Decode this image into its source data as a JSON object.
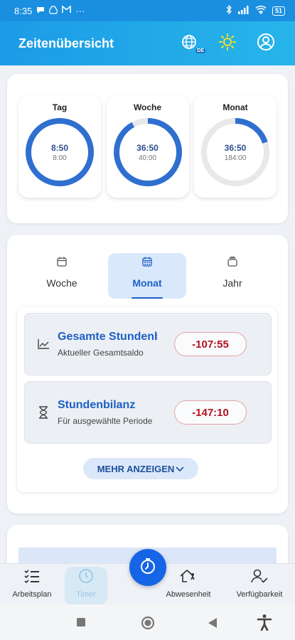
{
  "status_bar": {
    "time": "8:35",
    "notification_icons": [
      "chat-bubble-icon",
      "drive-icon",
      "gmail-icon"
    ],
    "more_indicator": "···",
    "battery": "51",
    "system_icons": [
      "bluetooth-icon",
      "signal-icon",
      "wifi-icon",
      "battery-icon"
    ]
  },
  "app_bar": {
    "title": "Zeitenübersicht",
    "language_badge": "DE",
    "icons": [
      "globe-language-icon",
      "sun-theme-icon",
      "account-icon"
    ]
  },
  "summary": {
    "rings": [
      {
        "label": "Tag",
        "value": "8:50",
        "target": "8:00",
        "progress": 1.0
      },
      {
        "label": "Woche",
        "value": "36:50",
        "target": "40:00",
        "progress": 0.92
      },
      {
        "label": "Monat",
        "value": "36:50",
        "target": "184:00",
        "progress": 0.2
      }
    ]
  },
  "period_tabs": {
    "selected": "Monat",
    "items": [
      {
        "label": "Woche",
        "icon": "calendar-week-icon"
      },
      {
        "label": "Monat",
        "icon": "calendar-month-icon"
      },
      {
        "label": "Jahr",
        "icon": "calendar-year-icon"
      }
    ]
  },
  "balances": [
    {
      "title": "Gesamte Stundenbi",
      "subtitle": "Aktueller Gesamtsaldo",
      "value": "-107:55",
      "icon": "trend-chart-icon"
    },
    {
      "title": "Stundenbilanz",
      "subtitle": "Für ausgewählte Periode",
      "value": "-147:10",
      "icon": "hourglass-icon"
    }
  ],
  "more_button": {
    "label": "MEHR ANZEIGEN",
    "icon": "chevron-down-icon"
  },
  "bottom_nav": {
    "items": [
      {
        "label": "Arbeitsplan",
        "icon": "checklist-icon"
      },
      {
        "label": "Timer",
        "icon": "clock-icon"
      },
      {
        "label": "Abwesenheit",
        "icon": "house-walk-icon"
      },
      {
        "label": "Verfügbarkeit",
        "icon": "person-check-icon"
      }
    ],
    "fab_icon": "stopwatch-icon"
  },
  "colors": {
    "app_bar": "#1c9be6",
    "ring_progress": "#2f6fd0",
    "accent": "#1d5fc7",
    "negative": "#b3121d",
    "fab": "#1565e6"
  }
}
